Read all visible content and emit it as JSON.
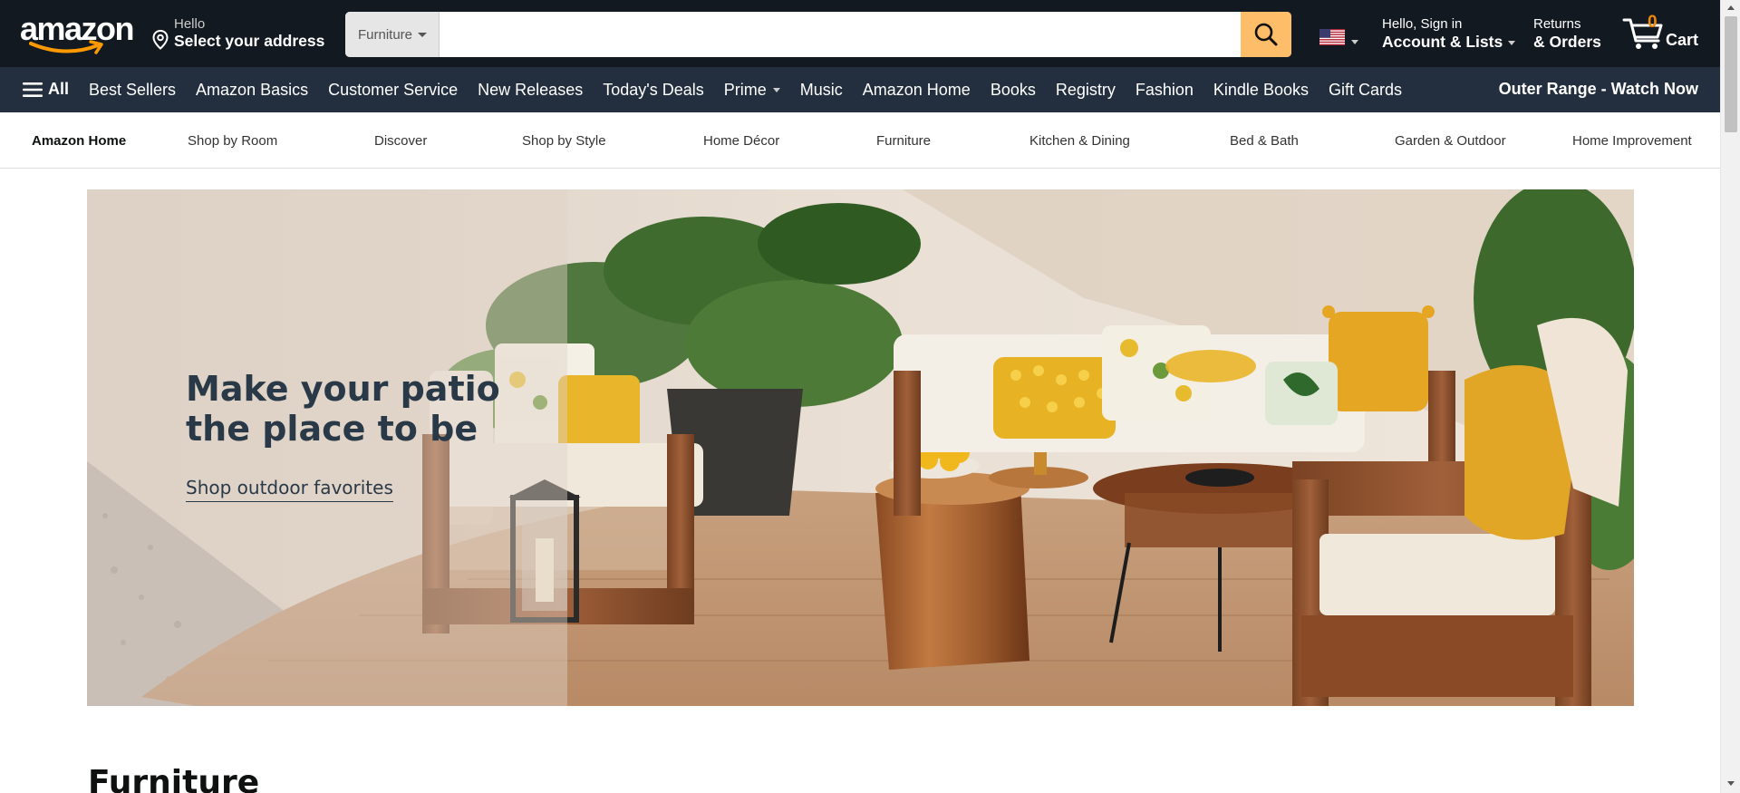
{
  "header": {
    "logo_text": "amazon",
    "location": {
      "hello": "Hello",
      "label": "Select your address",
      "icon": "location-pin-icon"
    },
    "search": {
      "category": "Furniture",
      "value": "",
      "placeholder": "",
      "button_icon": "search-icon"
    },
    "flag_icon": "us-flag-icon",
    "account": {
      "greeting": "Hello, Sign in",
      "label": "Account & Lists"
    },
    "returns": {
      "line1": "Returns",
      "line2": "& Orders"
    },
    "cart": {
      "count": "0",
      "label": "Cart",
      "icon": "cart-icon"
    }
  },
  "main_nav": {
    "all_label": "All",
    "items": [
      {
        "label": "Best Sellers"
      },
      {
        "label": "Amazon Basics"
      },
      {
        "label": "Customer Service"
      },
      {
        "label": "New Releases"
      },
      {
        "label": "Today's Deals"
      },
      {
        "label": "Prime",
        "has_caret": true
      },
      {
        "label": "Music"
      },
      {
        "label": "Amazon Home"
      },
      {
        "label": "Books"
      },
      {
        "label": "Registry"
      },
      {
        "label": "Fashion"
      },
      {
        "label": "Kindle Books"
      },
      {
        "label": "Gift Cards"
      }
    ],
    "promo": "Outer Range - Watch Now"
  },
  "sub_nav": {
    "items": [
      {
        "label": "Amazon Home"
      },
      {
        "label": "Shop by Room"
      },
      {
        "label": "Discover"
      },
      {
        "label": "Shop by Style"
      },
      {
        "label": "Home Décor"
      },
      {
        "label": "Furniture"
      },
      {
        "label": "Kitchen & Dining"
      },
      {
        "label": "Bed & Bath"
      },
      {
        "label": "Garden & Outdoor"
      },
      {
        "label": "Home Improvement"
      }
    ]
  },
  "hero": {
    "title_line1": "Make your patio",
    "title_line2": "the place to be",
    "link": "Shop outdoor favorites"
  },
  "section": {
    "title": "Furniture"
  },
  "colors": {
    "nav_top": "#131921",
    "nav_main": "#232f3e",
    "search_button": "#febd69",
    "cart_count": "#f08804",
    "hero_text": "#2a3947"
  }
}
